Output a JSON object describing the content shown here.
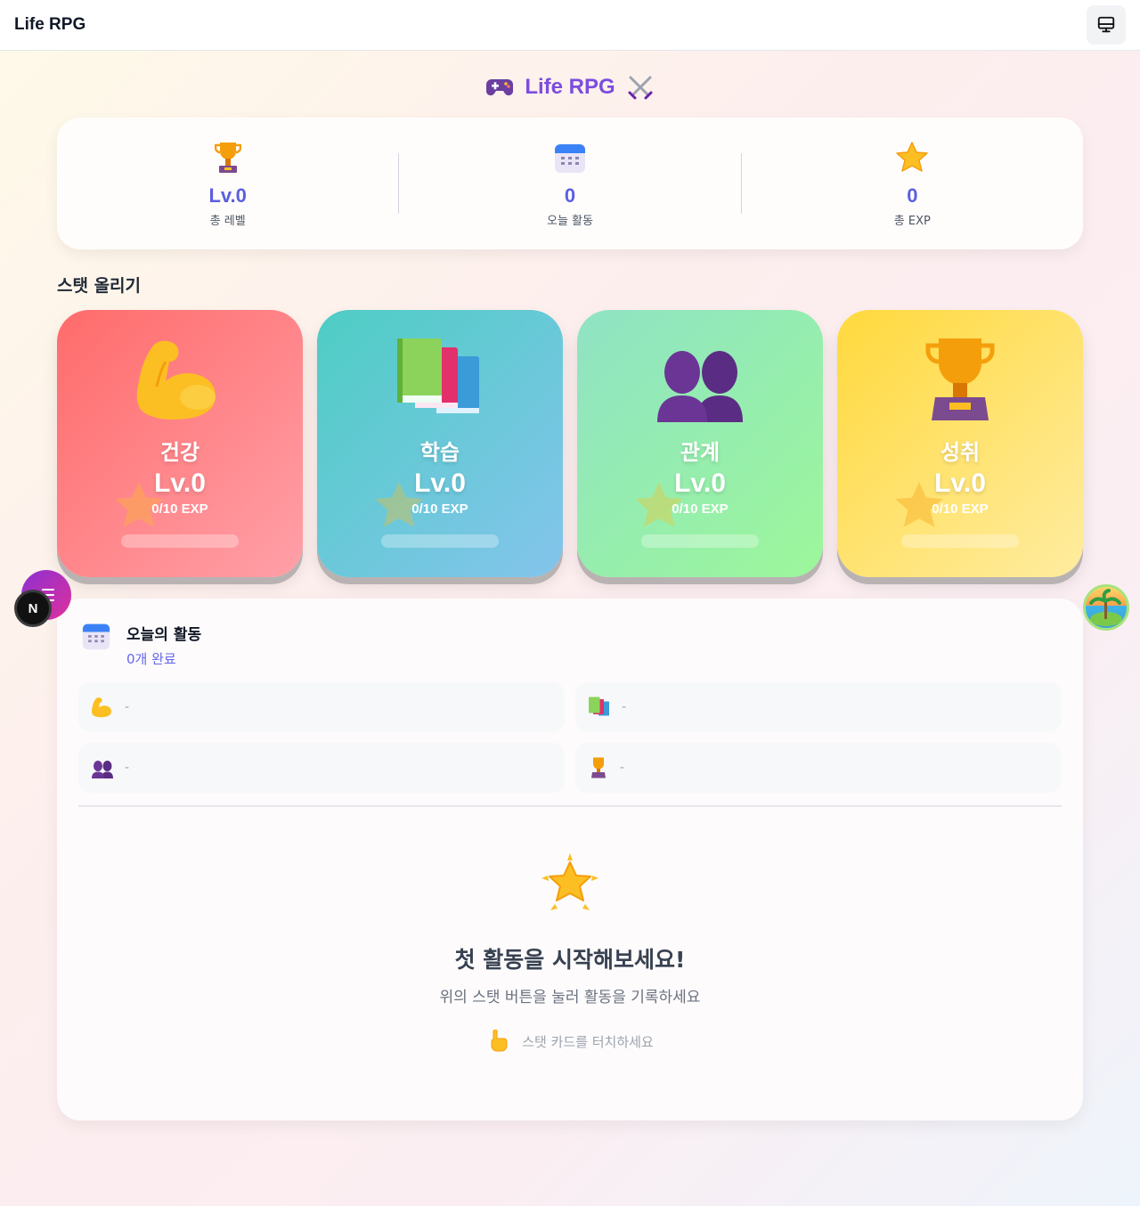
{
  "topbar": {
    "app_title": "Life RPG",
    "view_button_icon": "monitor-icon"
  },
  "hero": {
    "title": "Life RPG",
    "left_icon": "gamepad-icon",
    "right_icon": "crossed-swords-icon"
  },
  "summary": [
    {
      "icon": "trophy-icon",
      "value": "Lv.0",
      "label": "총 레벨"
    },
    {
      "icon": "calendar-icon",
      "value": "0",
      "label": "오늘 활동"
    },
    {
      "icon": "star-icon",
      "value": "0",
      "label": "총 EXP"
    }
  ],
  "section_title": "스탯 올리기",
  "stats": [
    {
      "name": "건강",
      "level": "Lv.0",
      "exp": "0/10 EXP",
      "progress": 0,
      "icon": "flexed-biceps-icon",
      "color": "#ff6b6b"
    },
    {
      "name": "학습",
      "level": "Lv.0",
      "exp": "0/10 EXP",
      "progress": 0,
      "icon": "books-icon",
      "color": "#4ecdc4"
    },
    {
      "name": "관계",
      "level": "Lv.0",
      "exp": "0/10 EXP",
      "progress": 0,
      "icon": "two-people-icon",
      "color": "#8fe3c4"
    },
    {
      "name": "성취",
      "level": "Lv.0",
      "exp": "0/10 EXP",
      "progress": 0,
      "icon": "trophy-icon",
      "color": "#ffd93d"
    }
  ],
  "floating": {
    "menu_icon": "menu-icon",
    "n_badge": "N",
    "island_icon": "island-icon"
  },
  "activity": {
    "title": "오늘의 활동",
    "subtitle": "0개 완료",
    "items": [
      {
        "icon": "flexed-biceps-icon",
        "text": "-"
      },
      {
        "icon": "books-icon",
        "text": "-"
      },
      {
        "icon": "two-people-icon",
        "text": "-"
      },
      {
        "icon": "trophy-icon",
        "text": "-"
      }
    ],
    "empty": {
      "title": "첫 활동을 시작해보세요!",
      "subtitle": "위의 스탯 버튼을 눌러 활동을 기록하세요",
      "hint": "스탯 카드를 터치하세요"
    }
  }
}
